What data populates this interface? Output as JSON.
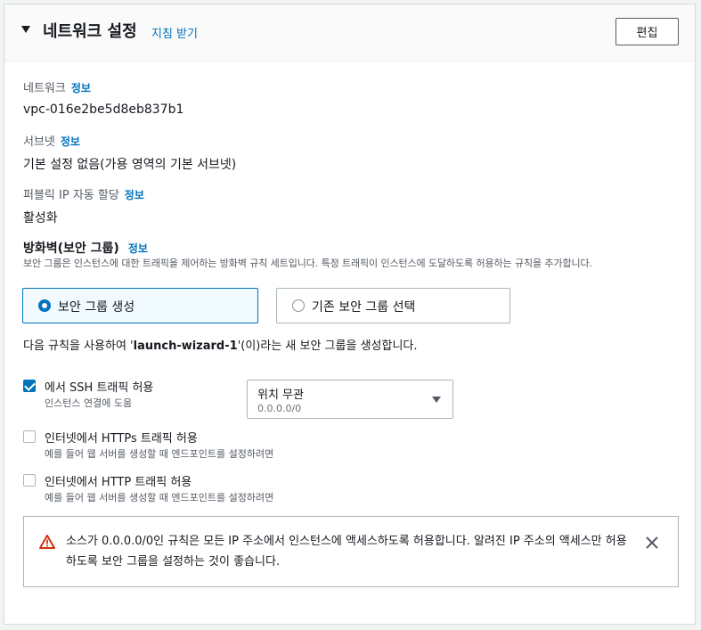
{
  "header": {
    "title": "네트워크 설정",
    "help_link": "지침 받기",
    "edit_label": "편집"
  },
  "network": {
    "label": "네트워크",
    "info": "정보",
    "value": "vpc-016e2be5d8eb837b1"
  },
  "subnet": {
    "label": "서브넷",
    "info": "정보",
    "value": "기본 설정 없음(가용 영역의 기본 서브넷)"
  },
  "public_ip": {
    "label": "퍼블릭 IP 자동 할당",
    "info": "정보",
    "value": "활성화"
  },
  "firewall": {
    "title": "방화벽(보안 그룹)",
    "info": "정보",
    "description": "보안 그룹은 인스턴스에 대한 트래픽을 제어하는 방화벽 규칙 세트입니다. 특정 트래픽이 인스턴스에 도달하도록 허용하는 규칙을 추가합니다.",
    "option_create": "보안 그룹 생성",
    "option_existing": "기존 보안 그룹 선택",
    "selected_option": "보안 그룹 생성"
  },
  "sentence": {
    "prefix": "다음 규칙을 사용하여 '",
    "group_name": "launch-wizard-1",
    "suffix": "'(이)라는 새 보안 그룹을 생성합니다."
  },
  "rules": [
    {
      "label": "에서 SSH 트래픽 허용",
      "sub": "인스턴스 연결에 도움",
      "checked": true
    },
    {
      "label": "인터넷에서 HTTPs 트래픽 허용",
      "sub": "예를 들어 웹 서버를 생성할 때 엔드포인트를 설정하려면",
      "checked": false
    },
    {
      "label": "인터넷에서 HTTP 트래픽 허용",
      "sub": "예를 들어 웹 서버를 생성할 때 엔드포인트를 설정하려면",
      "checked": false
    }
  ],
  "source_select": {
    "value": "위치 무관",
    "sub": "0.0.0.0/0"
  },
  "alert": {
    "text": "소스가 0.0.0.0/0인 규칙은 모든 IP 주소에서 인스턴스에 액세스하도록 허용합니다. 알려진 IP 주소의 액세스만 허용하도록 보안 그룹을 설정하는 것이 좋습니다."
  },
  "colors": {
    "link": "#0073bb",
    "warning": "#d13212",
    "text": "#16191f",
    "muted": "#545b64"
  }
}
